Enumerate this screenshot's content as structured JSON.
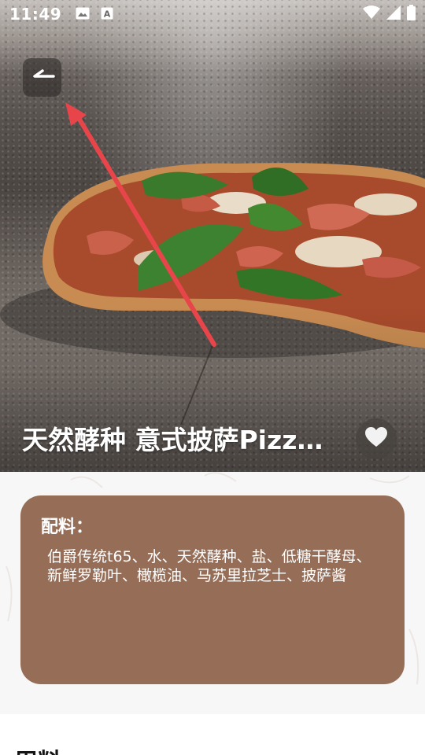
{
  "status_bar": {
    "time": "11:49",
    "left_icons": [
      "image-icon",
      "a-notification-icon"
    ],
    "right_icons": [
      "wifi-icon",
      "signal-icon",
      "battery-icon"
    ]
  },
  "header": {
    "back_icon": "back-arrow-icon"
  },
  "recipe": {
    "title": "天然酵种  意式披萨Pizz…",
    "favorite_icon": "heart-icon"
  },
  "ingredients": {
    "title": "配料：",
    "text": "伯爵传统t65、水、天然酵种、盐、低糖干酵母、新鲜罗勒叶、橄榄油、马苏里拉芝士、披萨酱",
    "card_color": "#966e58"
  },
  "section": {
    "heading": "用料"
  },
  "colors": {
    "annotation_arrow": "#e8454b",
    "card_background": "#966e58"
  }
}
